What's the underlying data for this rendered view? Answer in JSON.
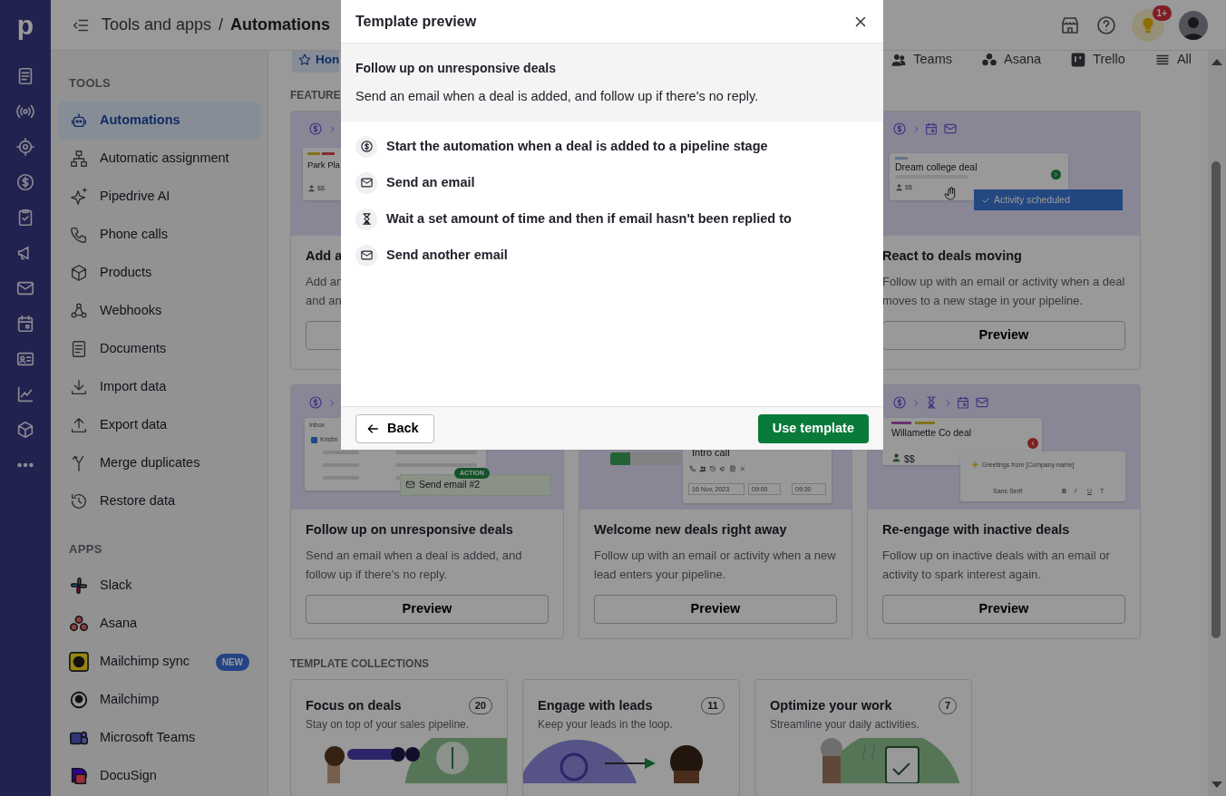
{
  "rail": {
    "logo": "p"
  },
  "header": {
    "breadcrumb": [
      "Tools and apps",
      "Automations"
    ],
    "separator": "/",
    "notification_badge": "1+"
  },
  "sidebar": {
    "sections": [
      {
        "title": "TOOLS",
        "items": [
          {
            "label": "Automations",
            "selected": true
          },
          {
            "label": "Automatic assignment",
            "selected": false
          },
          {
            "label": "Pipedrive AI",
            "selected": false
          },
          {
            "label": "Phone calls",
            "selected": false
          },
          {
            "label": "Products",
            "selected": false
          },
          {
            "label": "Webhooks",
            "selected": false
          },
          {
            "label": "Documents",
            "selected": false
          },
          {
            "label": "Import data",
            "selected": false
          },
          {
            "label": "Export data",
            "selected": false
          },
          {
            "label": "Merge duplicates",
            "selected": false
          },
          {
            "label": "Restore data",
            "selected": false
          }
        ]
      },
      {
        "title": "APPS",
        "items": [
          {
            "label": "Slack",
            "selected": false
          },
          {
            "label": "Asana",
            "selected": false
          },
          {
            "label": "Mailchimp sync",
            "selected": false,
            "badge": "NEW"
          },
          {
            "label": "Mailchimp",
            "selected": false
          },
          {
            "label": "Microsoft Teams",
            "selected": false
          },
          {
            "label": "DocuSign",
            "selected": false
          }
        ]
      }
    ]
  },
  "tabs": [
    {
      "label": "Hon",
      "selected": true
    },
    {
      "label": "Teams",
      "selected": false
    },
    {
      "label": "Asana",
      "selected": false
    },
    {
      "label": "Trello",
      "selected": false
    },
    {
      "label": "All",
      "selected": false
    }
  ],
  "featured": {
    "title": "FEATURE",
    "rows": [
      [
        {
          "kind": "partial",
          "title": "Add a",
          "description_lines": [
            "Add an",
            "and an"
          ],
          "illustration": {
            "kind": "deal",
            "texts": [
              "Park Pla",
              "$$"
            ]
          }
        },
        null,
        {
          "kind": "full",
          "title": "React to deals moving",
          "description": "Follow up with an email or activity when a deal moves to a new stage in your pipeline.",
          "button": "Preview",
          "illustration": {
            "kind": "activity",
            "texts": [
              "Dream college deal",
              "$$",
              "Activity scheduled"
            ]
          }
        }
      ],
      [
        {
          "kind": "full",
          "title": "Follow up on unresponsive deals",
          "description": "Send an email when a deal is added, and follow up if there's no reply.",
          "button": "Preview",
          "illustration": {
            "kind": "inbox",
            "checked": true,
            "texts": [
              "Inbox",
              "Kristin",
              "ACTION",
              "Send email #2"
            ]
          }
        },
        {
          "kind": "full",
          "title": "Welcome new deals right away",
          "description": "Follow up with an email or activity when a new lead enters your pipeline.",
          "button": "Preview",
          "illustration": {
            "kind": "call",
            "texts": [
              "Intro call",
              "16 Nov, 2023",
              "09:00",
              "09:30"
            ]
          }
        },
        {
          "kind": "full",
          "title": "Re-engage with inactive deals",
          "description": "Follow up on inactive deals with an email or activity to spark interest again.",
          "button": "Preview",
          "illustration": {
            "kind": "editor",
            "texts": [
              "Willamette Co deal",
              "$$",
              "Greetings from [Company name]",
              "Sans Serif",
              "B",
              "I",
              "U",
              "T"
            ]
          }
        }
      ]
    ]
  },
  "collections": {
    "title": "TEMPLATE COLLECTIONS",
    "items": [
      {
        "title": "Focus on deals",
        "count": "20",
        "description": "Stay on top of your sales pipeline."
      },
      {
        "title": "Engage with leads",
        "count": "11",
        "description": "Keep your leads in the loop."
      },
      {
        "title": "Optimize your work",
        "count": "7",
        "description": "Streamline your daily activities."
      }
    ]
  },
  "modal": {
    "title": "Template preview",
    "template_name": "Follow up on unresponsive deals",
    "template_description": "Send an email when a deal is added, and follow up if there's no reply.",
    "steps": [
      {
        "kind": "trigger",
        "label": "Start the automation when a deal is added to a pipeline stage"
      },
      {
        "kind": "email",
        "label": "Send an email"
      },
      {
        "kind": "wait",
        "label": "Wait a set amount of time and then if email hasn't been replied to"
      },
      {
        "kind": "email",
        "label": "Send another email"
      }
    ],
    "back_button": "Back",
    "primary_button": "Use template"
  }
}
